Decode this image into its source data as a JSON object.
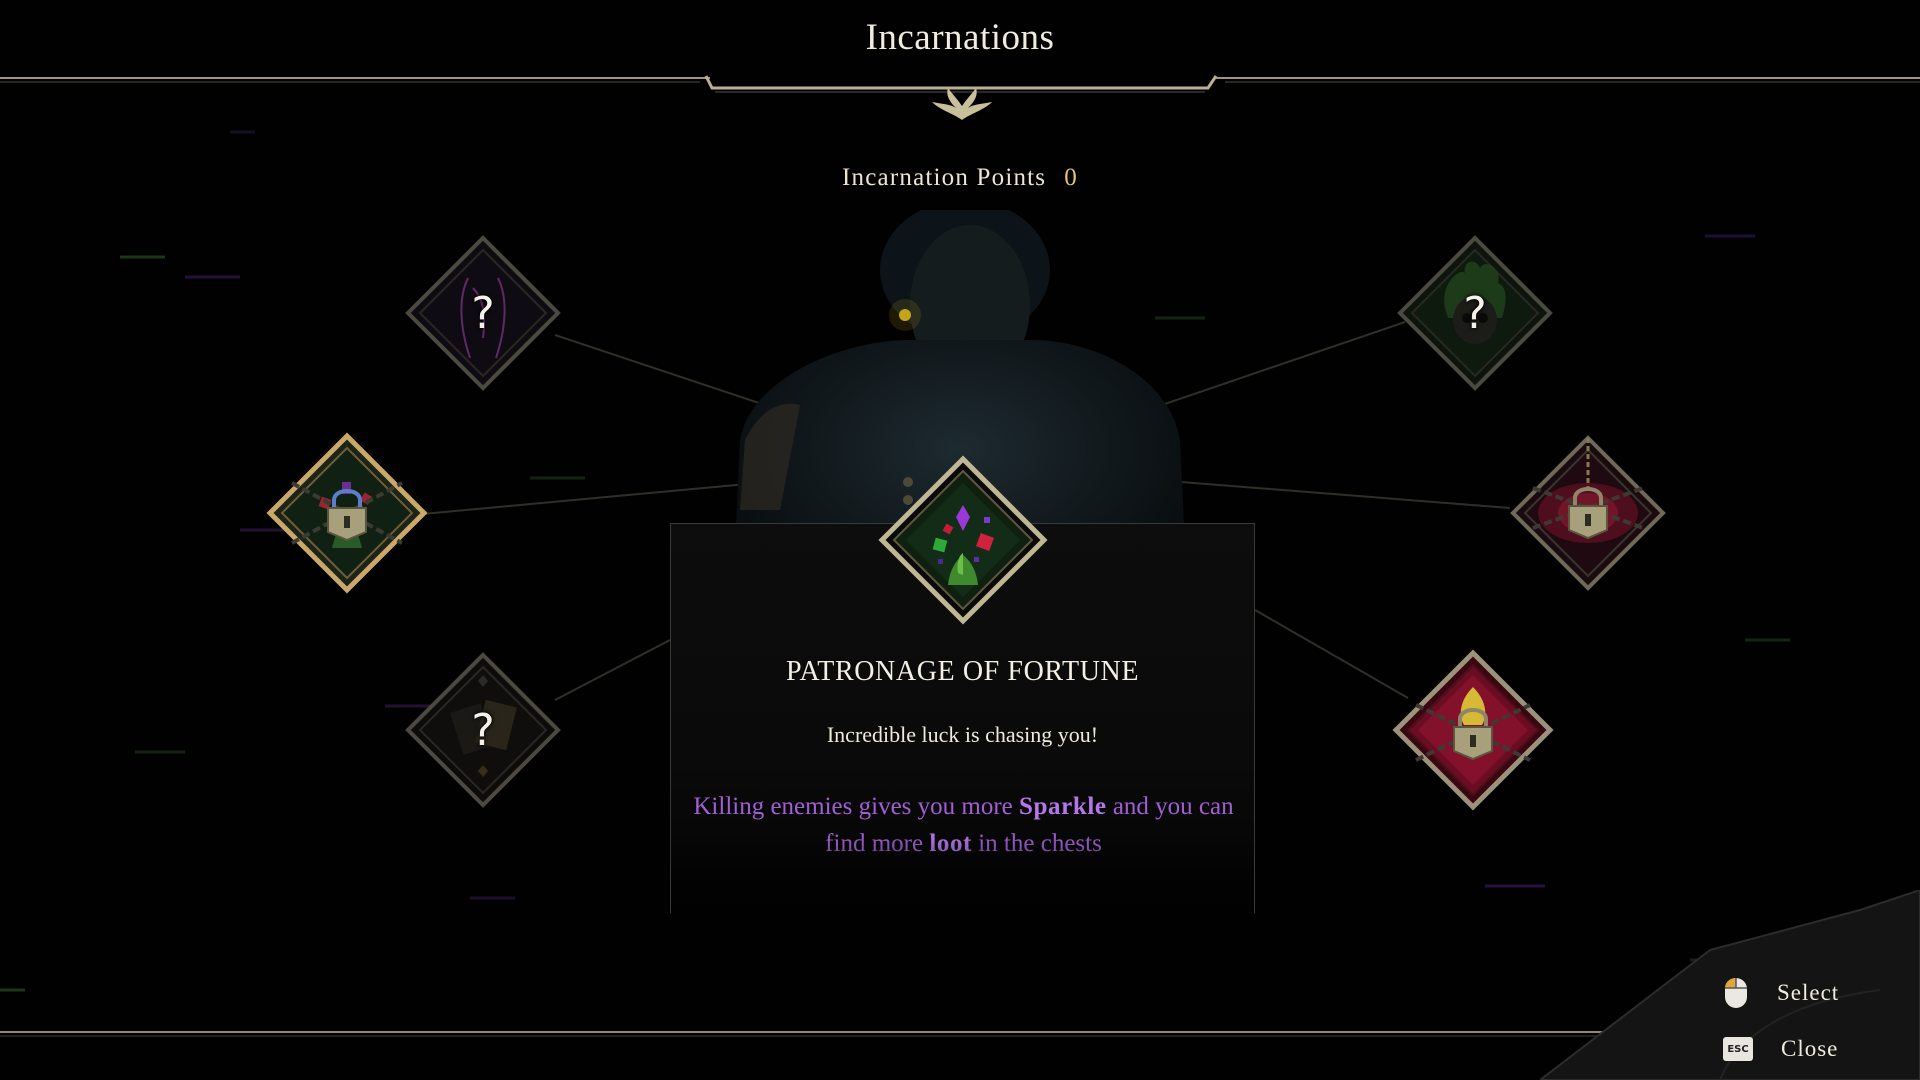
{
  "header": {
    "title": "Incarnations"
  },
  "points": {
    "label": "Incarnation Points",
    "value": "0"
  },
  "nodes": {
    "top_left": {
      "state": "unknown",
      "icon": "body-silhouette-icon",
      "label": "?"
    },
    "mid_left": {
      "state": "locked",
      "icon": "fortune-lock-icon"
    },
    "bottom_left": {
      "state": "unknown",
      "icon": "cards-icon",
      "label": "?"
    },
    "center": {
      "state": "selected",
      "icon": "gems-sprout-icon"
    },
    "top_right": {
      "state": "unknown",
      "icon": "green-skull-icon",
      "label": "?"
    },
    "mid_right": {
      "state": "locked",
      "icon": "red-burst-lock-icon"
    },
    "bottom_right": {
      "state": "locked",
      "icon": "crimson-flame-lock-icon"
    }
  },
  "tooltip": {
    "title": "PATRONAGE OF FORTUNE",
    "subtitle": "Incredible luck is chasing you!",
    "desc_1": "Killing enemies gives you more ",
    "desc_hl_1": "Sparkle",
    "desc_2": " and you can find more ",
    "desc_hl_2": "loot",
    "desc_3": " in the chests"
  },
  "controls": {
    "select": {
      "icon": "mouse-icon",
      "label": "Select"
    },
    "close": {
      "icon": "esc-key-icon",
      "key": "ESC",
      "label": "Close"
    }
  },
  "colors": {
    "accent_purple": "#a15fd6",
    "points_gold": "#e7c766",
    "frame_gold": "#b8b08f"
  }
}
